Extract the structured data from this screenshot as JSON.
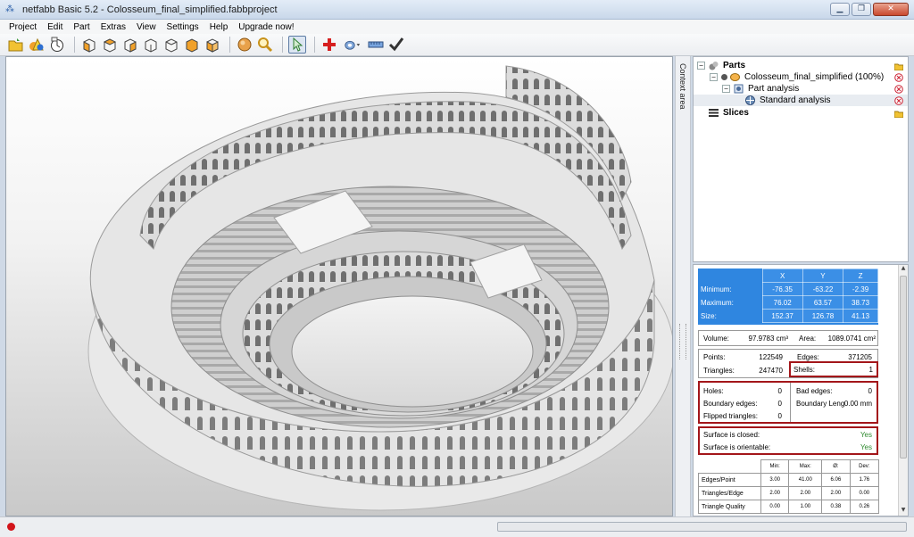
{
  "window": {
    "title": "netfabb Basic 5.2 - Colosseum_final_simplified.fabbproject",
    "minimize": "▁",
    "restore": "❐",
    "close": "✕"
  },
  "menu": [
    "Project",
    "Edit",
    "Part",
    "Extras",
    "View",
    "Settings",
    "Help",
    "Upgrade now!"
  ],
  "toolbar": {
    "icons": [
      "open-project-icon",
      "add-part-icon",
      "repair-icon",
      "view-iso-icon",
      "view-front-icon",
      "view-back-icon",
      "view-left-icon",
      "view-right-icon",
      "view-top-icon",
      "view-bottom-icon",
      "sphere-icon",
      "zoom-icon",
      "select-arrow-icon",
      "add-red-cross-icon",
      "measure-icon",
      "ruler-icon",
      "checkmark-icon"
    ]
  },
  "side_tab": {
    "label": "Context area"
  },
  "tree": {
    "parts_label": "Parts",
    "part_name": "Colosseum_final_simplified (100%)",
    "analysis_label": "Part analysis",
    "standard_label": "Standard analysis",
    "slices_label": "Slices"
  },
  "analysis": {
    "bbox_headers": [
      "X",
      "Y",
      "Z"
    ],
    "bbox_rows": [
      {
        "label": "Minimum:",
        "x": "-76.35",
        "y": "-63.22",
        "z": "-2.39"
      },
      {
        "label": "Maximum:",
        "x": "76.02",
        "y": "63.57",
        "z": "38.73"
      },
      {
        "label": "Size:",
        "x": "152.37",
        "y": "126.78",
        "z": "41.13"
      }
    ],
    "volume_label": "Volume:",
    "volume_value": "97.9783 cm³",
    "area_label": "Area:",
    "area_value": "1089.0741 cm²",
    "points_label": "Points:",
    "points_value": "122549",
    "edges_label": "Edges:",
    "edges_value": "371205",
    "triangles_label": "Triangles:",
    "triangles_value": "247470",
    "shells_label": "Shells:",
    "shells_value": "1",
    "holes_label": "Holes:",
    "holes_value": "0",
    "bad_edges_label": "Bad edges:",
    "bad_edges_value": "0",
    "boundary_edges_label": "Boundary edges:",
    "boundary_edges_value": "0",
    "boundary_length_label": "Boundary Leng",
    "boundary_length_value": "0.00 mm",
    "flipped_label": "Flipped triangles:",
    "flipped_value": "0",
    "closed_label": "Surface is closed:",
    "closed_value": "Yes",
    "orientable_label": "Surface is orientable:",
    "orientable_value": "Yes",
    "stats_headers": [
      "Min:",
      "Max:",
      "Ø:",
      "Dev:"
    ],
    "stats_rows": [
      {
        "label": "Edges/Point",
        "min": "3.00",
        "max": "41.00",
        "avg": "6.06",
        "dev": "1.76"
      },
      {
        "label": "Triangles/Edge",
        "min": "2.00",
        "max": "2.00",
        "avg": "2.00",
        "dev": "0.00"
      },
      {
        "label": "Triangle Quality",
        "min": "0.00",
        "max": "1.00",
        "avg": "0.38",
        "dev": "0.26"
      }
    ]
  },
  "colors": {
    "bbox_blue": "#2f86e0",
    "highlight_red": "#a3161a",
    "yes_green": "#2f8a2f",
    "status_red": "#d2141a"
  }
}
